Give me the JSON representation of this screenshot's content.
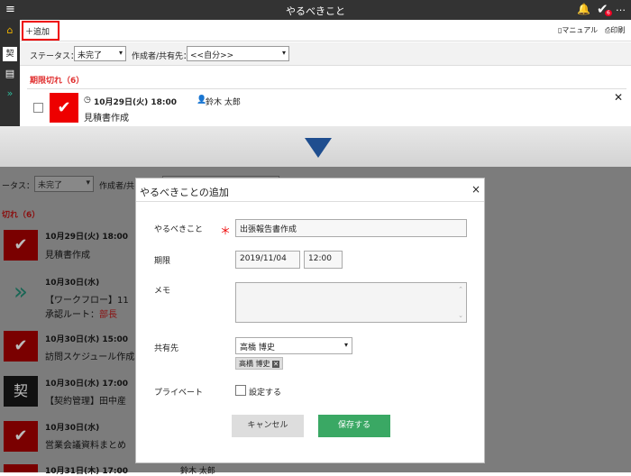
{
  "topbar": {
    "menu_icon": "≡",
    "title": "やるべきこと",
    "badge": "6",
    "more": "…"
  },
  "toolbar": {
    "add": "＋追加",
    "manual": "マニュアル",
    "print": "印刷"
  },
  "filter": {
    "status_label": "ステータス：",
    "status_value": "未完了",
    "creator_label": "作成者/共有先：",
    "creator_value": "<<自分>>"
  },
  "overdue_header": "期限切れ（6）",
  "card1": {
    "date": "10月29日(火) 18:00",
    "user": "鈴木 太郎",
    "title": "見積書作成"
  },
  "background": {
    "status_label": "ータス：",
    "status_value": "未完了",
    "creator_label": "作成者/共",
    "overdue_header": "切れ（6）",
    "items": [
      {
        "date": "10月29日(火) 18:00",
        "title": "見積書作成"
      },
      {
        "date": "10月30日(水)",
        "title": "【ワークフロー】11",
        "sub_prefix": "承認ルート：",
        "sub_highlight": "部長"
      },
      {
        "date": "10月30日(水) 15:00",
        "title": "訪問スケジュール作成"
      },
      {
        "date": "10月30日(水) 17:00",
        "title": "【契約管理】田中産"
      },
      {
        "date": "10月30日(水)",
        "title": "営業会議資料まとめ"
      },
      {
        "date": "10月31日(木) 17:00",
        "title": "",
        "user": "鈴木 太郎"
      }
    ],
    "contract_icon": "契"
  },
  "modal": {
    "title": "やるべきことの追加",
    "close": "×",
    "task_label": "やるべきこと",
    "required": "＊",
    "task_value": "出張報告書作成",
    "due_label": "期限",
    "due_date": "2019/11/04",
    "due_time": "12:00",
    "memo_label": "メモ",
    "share_label": "共有先",
    "share_value": "高橋 博史",
    "share_tag": "高橋 博史",
    "private_label": "プライベート",
    "private_option": "設定する",
    "cancel": "キャンセル",
    "save": "保存する"
  },
  "colors": {
    "accent_red": "#e00000",
    "save_green": "#3aa864",
    "arrow_blue": "#1f4e8f"
  }
}
